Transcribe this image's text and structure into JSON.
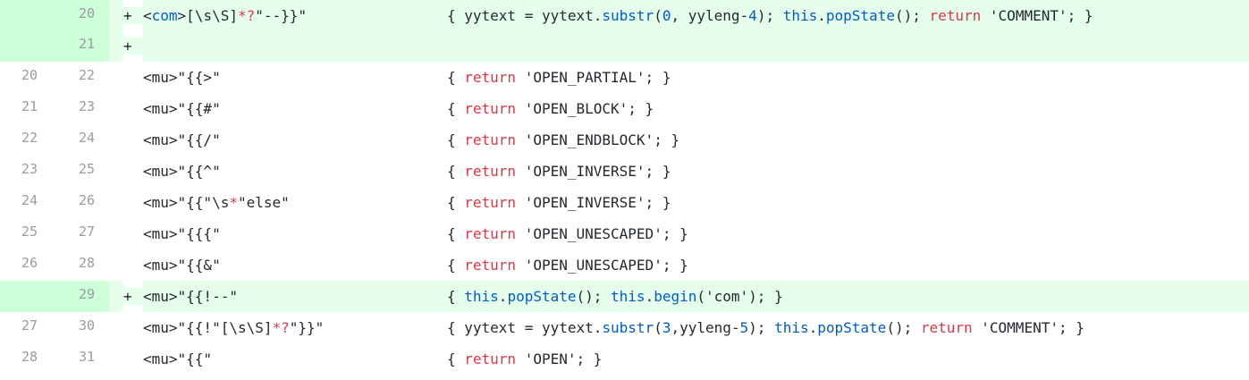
{
  "diff": {
    "rows": [
      {
        "type": "added",
        "old": "",
        "new": "20",
        "marker": "+",
        "tokens": [
          {
            "t": "<",
            "c": "plain"
          },
          {
            "t": "com",
            "c": "fn"
          },
          {
            "t": ">[\\s\\S]",
            "c": "plain"
          },
          {
            "t": "*?",
            "c": "op"
          },
          {
            "t": "\"--}}\"",
            "c": "plain"
          }
        ],
        "action": [
          {
            "t": "{ yytext = yytext.",
            "c": "plain"
          },
          {
            "t": "substr",
            "c": "fn"
          },
          {
            "t": "(",
            "c": "plain"
          },
          {
            "t": "0",
            "c": "num-lit"
          },
          {
            "t": ", yyleng-",
            "c": "plain"
          },
          {
            "t": "4",
            "c": "num-lit"
          },
          {
            "t": "); ",
            "c": "plain"
          },
          {
            "t": "this",
            "c": "fn"
          },
          {
            "t": ".",
            "c": "plain"
          },
          {
            "t": "popState",
            "c": "fn"
          },
          {
            "t": "(); ",
            "c": "plain"
          },
          {
            "t": "return",
            "c": "kw"
          },
          {
            "t": " 'COMMENT'; }",
            "c": "plain"
          }
        ]
      },
      {
        "type": "added",
        "old": "",
        "new": "21",
        "marker": "+",
        "tokens": [],
        "action": []
      },
      {
        "type": "context",
        "old": "20",
        "new": "22",
        "marker": "",
        "tokens": [
          {
            "t": "<mu>\"{{>\"",
            "c": "plain"
          }
        ],
        "action": [
          {
            "t": "{ ",
            "c": "plain"
          },
          {
            "t": "return",
            "c": "kw"
          },
          {
            "t": " 'OPEN_PARTIAL'; }",
            "c": "plain"
          }
        ]
      },
      {
        "type": "context",
        "old": "21",
        "new": "23",
        "marker": "",
        "tokens": [
          {
            "t": "<mu>\"{{#\"",
            "c": "plain"
          }
        ],
        "action": [
          {
            "t": "{ ",
            "c": "plain"
          },
          {
            "t": "return",
            "c": "kw"
          },
          {
            "t": " 'OPEN_BLOCK'; }",
            "c": "plain"
          }
        ]
      },
      {
        "type": "context",
        "old": "22",
        "new": "24",
        "marker": "",
        "tokens": [
          {
            "t": "<mu>\"{{/\"",
            "c": "plain"
          }
        ],
        "action": [
          {
            "t": "{ ",
            "c": "plain"
          },
          {
            "t": "return",
            "c": "kw"
          },
          {
            "t": " 'OPEN_ENDBLOCK'; }",
            "c": "plain"
          }
        ]
      },
      {
        "type": "context",
        "old": "23",
        "new": "25",
        "marker": "",
        "tokens": [
          {
            "t": "<mu>\"{{^\"",
            "c": "plain"
          }
        ],
        "action": [
          {
            "t": "{ ",
            "c": "plain"
          },
          {
            "t": "return",
            "c": "kw"
          },
          {
            "t": " 'OPEN_INVERSE'; }",
            "c": "plain"
          }
        ]
      },
      {
        "type": "context",
        "old": "24",
        "new": "26",
        "marker": "",
        "tokens": [
          {
            "t": "<mu>\"{{\"\\s",
            "c": "plain"
          },
          {
            "t": "*",
            "c": "op"
          },
          {
            "t": "\"else\"",
            "c": "plain"
          }
        ],
        "action": [
          {
            "t": "{ ",
            "c": "plain"
          },
          {
            "t": "return",
            "c": "kw"
          },
          {
            "t": " 'OPEN_INVERSE'; }",
            "c": "plain"
          }
        ]
      },
      {
        "type": "context",
        "old": "25",
        "new": "27",
        "marker": "",
        "tokens": [
          {
            "t": "<mu>\"{{{\"",
            "c": "plain"
          }
        ],
        "action": [
          {
            "t": "{ ",
            "c": "plain"
          },
          {
            "t": "return",
            "c": "kw"
          },
          {
            "t": " 'OPEN_UNESCAPED'; }",
            "c": "plain"
          }
        ]
      },
      {
        "type": "context",
        "old": "26",
        "new": "28",
        "marker": "",
        "tokens": [
          {
            "t": "<mu>\"{{&\"",
            "c": "plain"
          }
        ],
        "action": [
          {
            "t": "{ ",
            "c": "plain"
          },
          {
            "t": "return",
            "c": "kw"
          },
          {
            "t": " 'OPEN_UNESCAPED'; }",
            "c": "plain"
          }
        ]
      },
      {
        "type": "added",
        "old": "",
        "new": "29",
        "marker": "+",
        "tokens": [
          {
            "t": "<mu>\"{{!--\"",
            "c": "plain"
          }
        ],
        "action": [
          {
            "t": "{ ",
            "c": "plain"
          },
          {
            "t": "this",
            "c": "fn"
          },
          {
            "t": ".",
            "c": "plain"
          },
          {
            "t": "popState",
            "c": "fn"
          },
          {
            "t": "(); ",
            "c": "plain"
          },
          {
            "t": "this",
            "c": "fn"
          },
          {
            "t": ".",
            "c": "plain"
          },
          {
            "t": "begin",
            "c": "fn"
          },
          {
            "t": "('com'); }",
            "c": "plain"
          }
        ]
      },
      {
        "type": "context",
        "old": "27",
        "new": "30",
        "marker": "",
        "tokens": [
          {
            "t": "<mu>\"{{!\"[\\s\\S]",
            "c": "plain"
          },
          {
            "t": "*?",
            "c": "op"
          },
          {
            "t": "\"}}\"",
            "c": "plain"
          }
        ],
        "action": [
          {
            "t": "{ yytext = yytext.",
            "c": "plain"
          },
          {
            "t": "substr",
            "c": "fn"
          },
          {
            "t": "(",
            "c": "plain"
          },
          {
            "t": "3",
            "c": "num-lit"
          },
          {
            "t": ",yyleng-",
            "c": "plain"
          },
          {
            "t": "5",
            "c": "num-lit"
          },
          {
            "t": "); ",
            "c": "plain"
          },
          {
            "t": "this",
            "c": "fn"
          },
          {
            "t": ".",
            "c": "plain"
          },
          {
            "t": "popState",
            "c": "fn"
          },
          {
            "t": "(); ",
            "c": "plain"
          },
          {
            "t": "return",
            "c": "kw"
          },
          {
            "t": " 'COMMENT'; }",
            "c": "plain"
          }
        ]
      },
      {
        "type": "context",
        "old": "28",
        "new": "31",
        "marker": "",
        "tokens": [
          {
            "t": "<mu>\"{{\"",
            "c": "plain"
          }
        ],
        "action": [
          {
            "t": "{ ",
            "c": "plain"
          },
          {
            "t": "return",
            "c": "kw"
          },
          {
            "t": " 'OPEN'; }",
            "c": "plain"
          }
        ]
      }
    ]
  }
}
